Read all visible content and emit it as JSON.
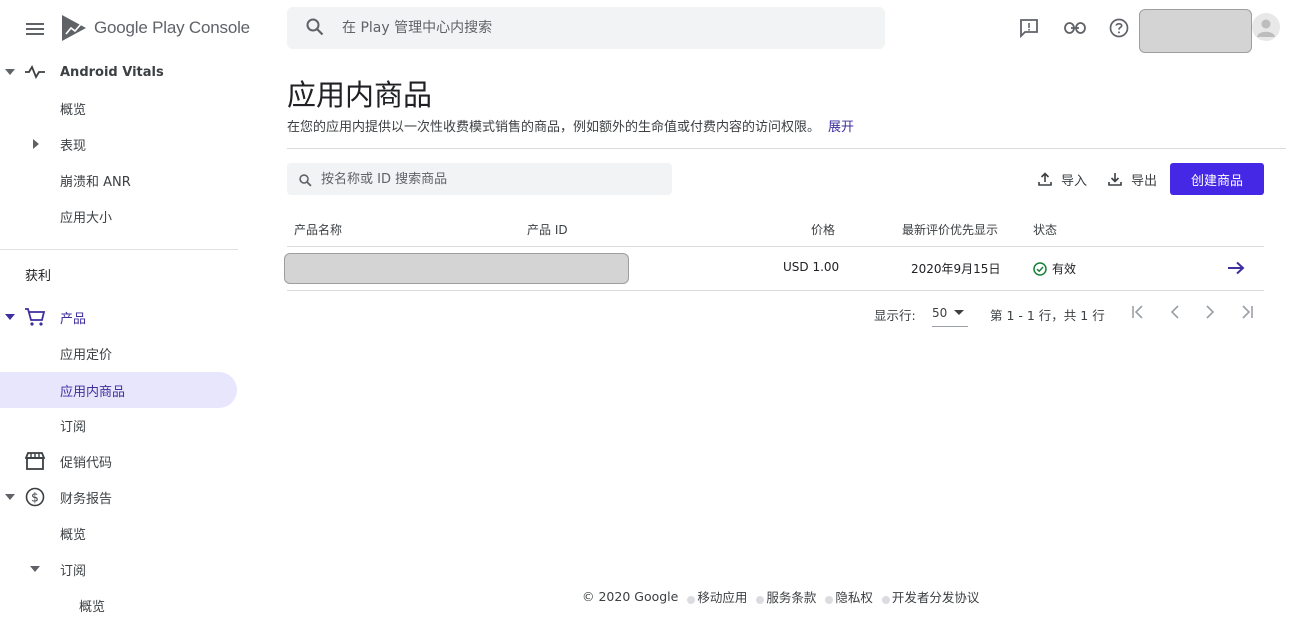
{
  "brand": {
    "logo_text": "Google Play Console"
  },
  "top": {
    "search_placeholder": "在 Play 管理中心内搜索",
    "icons": [
      "feedback-icon",
      "link-icon",
      "help-icon"
    ]
  },
  "sidebar": {
    "vitals": "Android Vitals",
    "vitals_items": [
      "概览",
      "表现",
      "崩溃和 ANR",
      "应用大小"
    ],
    "section_monetize": "获利",
    "products": "产品",
    "products_items": [
      "应用定价",
      "应用内商品",
      "订阅"
    ],
    "promo": "促销代码",
    "finance": "财务报告",
    "finance_items": [
      "概览",
      "订阅"
    ],
    "finance_sub_items": [
      "概览"
    ]
  },
  "main": {
    "title": "应用内商品",
    "description": "在您的应用内提供以一次性收费模式销售的商品，例如额外的生命值或付费内容的访问权限。",
    "expand_link": "展开",
    "search_placeholder": "按名称或 ID 搜索商品",
    "import_label": "导入",
    "export_label": "导出",
    "create_label": "创建商品",
    "accent_color": "#4528e6"
  },
  "table": {
    "headers": {
      "name": "产品名称",
      "id": "产品 ID",
      "price": "价格",
      "updated": "最新评价优先显示",
      "status": "状态"
    },
    "rows": [
      {
        "price": "USD 1.00",
        "updated": "2020年9月15日",
        "status": "有效"
      }
    ]
  },
  "pagination": {
    "rows_label": "显示行:",
    "rows_value": "50",
    "info": "第 1 - 1 行，共 1 行"
  },
  "footer": {
    "copyright": "© 2020 Google",
    "links": [
      "移动应用",
      "服务条款",
      "隐私权",
      "开发者分发协议"
    ]
  }
}
